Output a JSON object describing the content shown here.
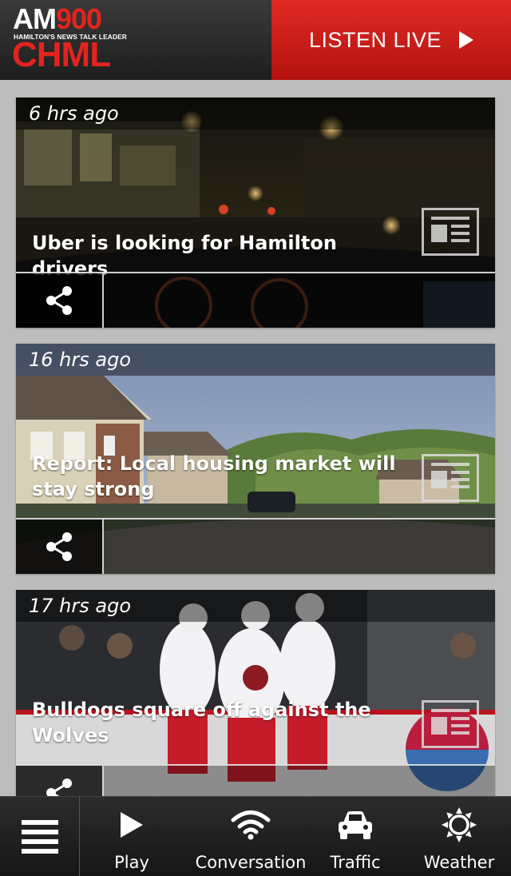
{
  "header": {
    "logo": {
      "am": "AM",
      "number": "900",
      "tagline": "HAMILTON'S NEWS TALK LEADER",
      "station": "CHML"
    },
    "listen_live": "LISTEN LIVE"
  },
  "colors": {
    "brand_red": "#e3231f",
    "header_dark": "#2a2a2a",
    "nav_dark": "#1e1e1e"
  },
  "feed": {
    "cards": [
      {
        "time": "6 hrs ago",
        "title": "Uber is looking for Hamilton drivers",
        "type_icon": "article-icon"
      },
      {
        "time": "16 hrs ago",
        "title": "Report: Local housing market will stay strong",
        "type_icon": "article-icon"
      },
      {
        "time": "17 hrs ago",
        "title": "Bulldogs square off against the Wolves",
        "type_icon": "article-icon"
      }
    ]
  },
  "nav": {
    "menu_icon": "hamburger-menu-icon",
    "items": [
      {
        "label": "Play",
        "icon": "play-icon"
      },
      {
        "label": "Conversation",
        "icon": "wifi-icon"
      },
      {
        "label": "Traffic",
        "icon": "car-icon"
      },
      {
        "label": "Weather",
        "icon": "sun-icon"
      }
    ]
  }
}
